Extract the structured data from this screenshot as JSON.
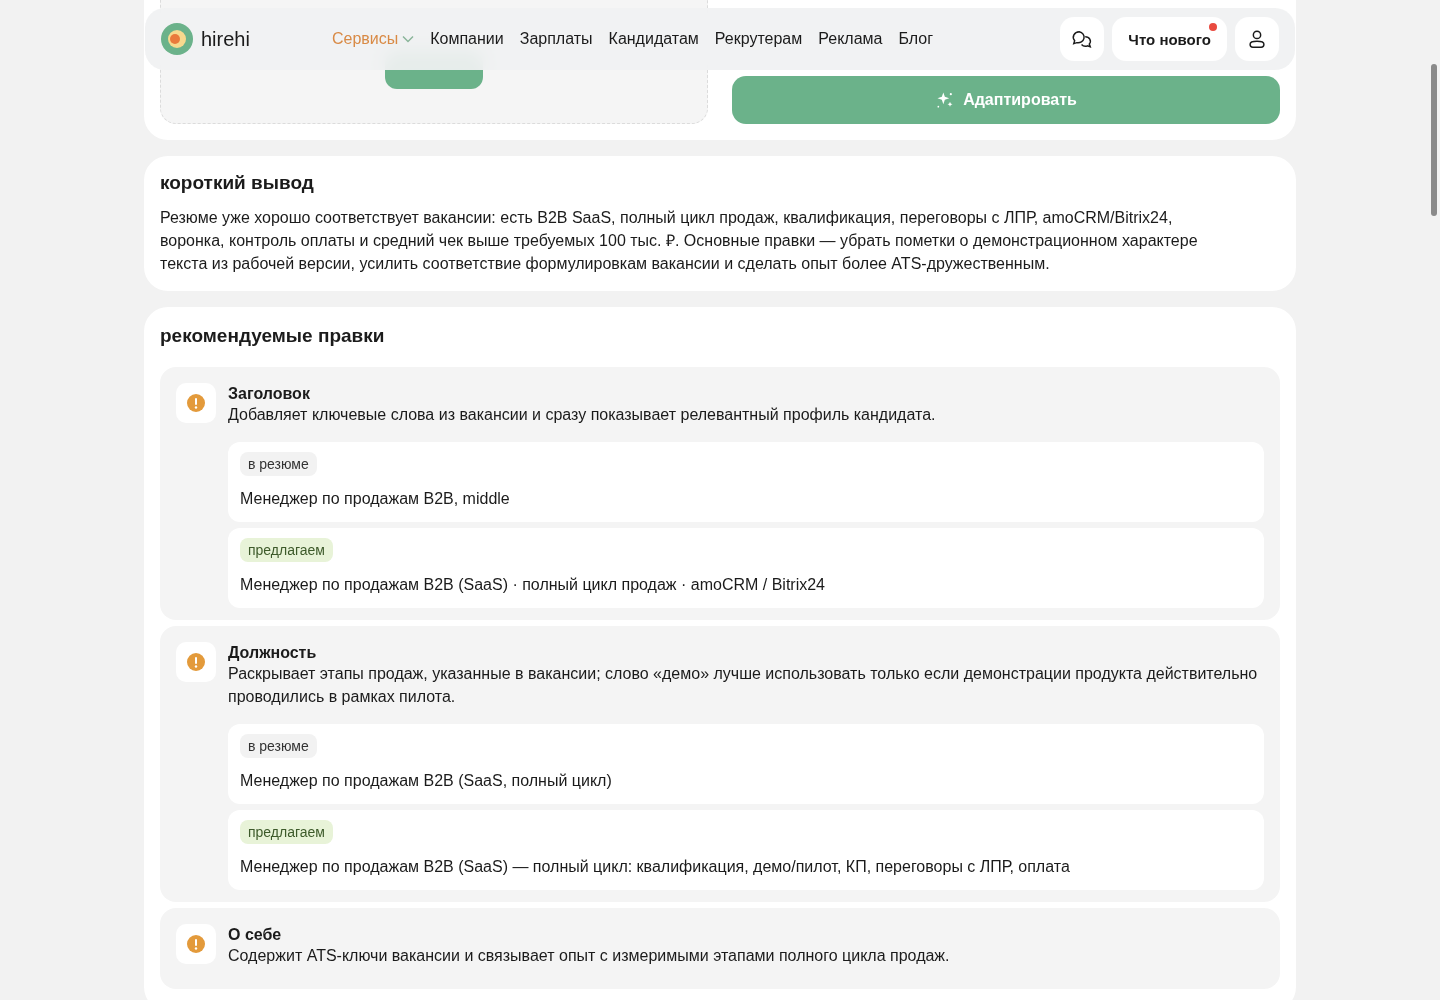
{
  "header": {
    "logo": "hirehi",
    "nav": [
      {
        "label": "Сервисы",
        "selected": true,
        "dropdown": true
      },
      {
        "label": "Компании",
        "selected": false,
        "dropdown": false
      },
      {
        "label": "Зарплаты",
        "selected": false,
        "dropdown": false
      },
      {
        "label": "Кандидатам",
        "selected": false,
        "dropdown": false
      },
      {
        "label": "Рекрутерам",
        "selected": false,
        "dropdown": false
      },
      {
        "label": "Реклама",
        "selected": false,
        "dropdown": false
      },
      {
        "label": "Блог",
        "selected": false,
        "dropdown": false
      }
    ],
    "whats_new": {
      "label": "Что нового",
      "unread": true
    }
  },
  "adapt_button": "Адаптировать",
  "summary": {
    "title": "короткий вывод",
    "text": "Резюме уже хорошо соответствует вакансии: есть B2B SaaS, полный цикл продаж, квалификация, переговоры с ЛПР, amoCRM/Bitrix24, воронка, контроль оплаты и средний чек выше требуемых 100 тыс. ₽. Основные правки — убрать пометки о демонстрационном характере текста из рабочей версии, усилить соответствие формулировкам вакансии и сделать опыт более ATS-дружественным."
  },
  "edits": {
    "title": "рекомендуемые правки",
    "items": [
      {
        "title": "Заголовок",
        "description": "Добавляет ключевые слова из вакансии и сразу показывает релевантный профиль кандидата.",
        "versions": [
          {
            "kind": "current",
            "tag": "в резюме",
            "text": "Менеджер по продажам B2B, middle"
          },
          {
            "kind": "suggested",
            "tag": "предлагаем",
            "text": "Менеджер по продажам B2B (SaaS) · полный цикл продаж · amoCRM / Bitrix24"
          }
        ]
      },
      {
        "title": "Должность",
        "description": "Раскрывает этапы продаж, указанные в вакансии; слово «демо» лучше использовать только если демонстрации продукта действительно проводились в рамках пилота.",
        "versions": [
          {
            "kind": "current",
            "tag": "в резюме",
            "text": "Менеджер по продажам B2B (SaaS, полный цикл)"
          },
          {
            "kind": "suggested",
            "tag": "предлагаем",
            "text": "Менеджер по продажам B2B (SaaS) — полный цикл: квалификация, демо/пилот, КП, переговоры с ЛПР, оплата"
          }
        ]
      },
      {
        "title": "О себе",
        "description": "Содержит ATS-ключи вакансии и связывает опыт с измеримыми этапами полного цикла продаж."
      }
    ]
  }
}
